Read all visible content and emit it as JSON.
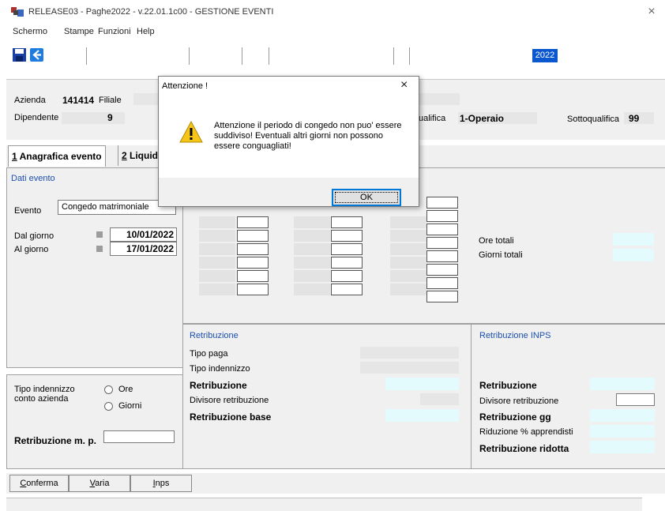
{
  "window": {
    "title": "RELEASE03 - Paghe2022 - v.22.01.1c00 - GESTIONE EVENTI",
    "close": "×"
  },
  "menu": [
    "Schermo",
    "Stampe",
    "Funzioni",
    "Help"
  ],
  "toolbar": {
    "year": "2022"
  },
  "header": {
    "azienda_label": "Azienda",
    "azienda_value": "141414",
    "filiale_label": "Filiale",
    "dipendente_label": "Dipendente",
    "dipendente_value": "9",
    "qualifica_label": "ualifica",
    "qualifica_value": "1-Operaio",
    "sottoqualifica_label": "Sottoqualifica",
    "sottoqualifica_value": "99"
  },
  "tabs": [
    {
      "num": "1",
      "label": " Anagrafica evento"
    },
    {
      "num": "2",
      "label": " Liquid"
    }
  ],
  "dati_evento": {
    "title": "Dati evento",
    "evento_label": "Evento",
    "evento_value": "Congedo matrimoniale",
    "dal_label": "Dal giorno",
    "dal_value": "10/01/2022",
    "al_label": "Al giorno",
    "al_value": "17/01/2022"
  },
  "totali": {
    "ore_label": "Ore totali",
    "giorni_label": "Giorni totali"
  },
  "indennizzo": {
    "label1": "Tipo indennizzo",
    "label2": "conto azienda",
    "opt_ore": "Ore",
    "opt_giorni": "Giorni",
    "retrib_mp_label": "Retribuzione m. p."
  },
  "retribuzione": {
    "title": "Retribuzione",
    "tipo_paga": "Tipo paga",
    "tipo_indennizzo": "Tipo indennizzo",
    "retribuzione": "Retribuzione",
    "divisore": "Divisore retribuzione",
    "retribuzione_base": "Retribuzione base"
  },
  "retribuzione_inps": {
    "title": "Retribuzione INPS",
    "retribuzione": "Retribuzione",
    "divisore": "Divisore retribuzione",
    "retribuzione_gg": "Retribuzione gg",
    "riduzione": "Riduzione % apprendisti",
    "retribuzione_ridotta": "Retribuzione ridotta"
  },
  "buttons": [
    {
      "first": "C",
      "rest": "onferma"
    },
    {
      "first": "V",
      "rest": "aria"
    },
    {
      "first": "I",
      "rest": "nps"
    }
  ],
  "dialog": {
    "title": "Attenzione !",
    "close": "×",
    "message": "Attenzione il periodo di congedo non puo' essere suddiviso! Eventuali altri giorni non possono essere conguagliati!",
    "ok": "OK"
  },
  "colors": {
    "accent": "#0b57d0",
    "section_title": "#1c4fb0",
    "cyan_field": "#e4fbfd"
  }
}
